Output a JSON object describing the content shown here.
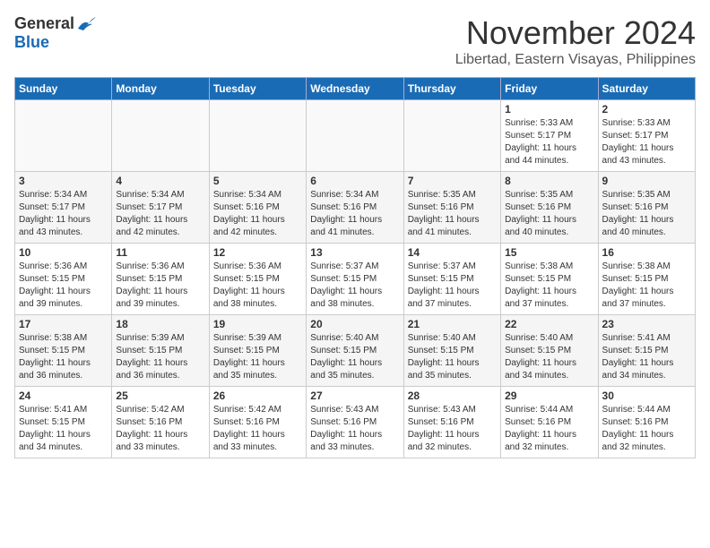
{
  "header": {
    "logo_general": "General",
    "logo_blue": "Blue",
    "month_title": "November 2024",
    "location": "Libertad, Eastern Visayas, Philippines"
  },
  "weekdays": [
    "Sunday",
    "Monday",
    "Tuesday",
    "Wednesday",
    "Thursday",
    "Friday",
    "Saturday"
  ],
  "weeks": [
    [
      {
        "day": "",
        "info": ""
      },
      {
        "day": "",
        "info": ""
      },
      {
        "day": "",
        "info": ""
      },
      {
        "day": "",
        "info": ""
      },
      {
        "day": "",
        "info": ""
      },
      {
        "day": "1",
        "info": "Sunrise: 5:33 AM\nSunset: 5:17 PM\nDaylight: 11 hours\nand 44 minutes."
      },
      {
        "day": "2",
        "info": "Sunrise: 5:33 AM\nSunset: 5:17 PM\nDaylight: 11 hours\nand 43 minutes."
      }
    ],
    [
      {
        "day": "3",
        "info": "Sunrise: 5:34 AM\nSunset: 5:17 PM\nDaylight: 11 hours\nand 43 minutes."
      },
      {
        "day": "4",
        "info": "Sunrise: 5:34 AM\nSunset: 5:17 PM\nDaylight: 11 hours\nand 42 minutes."
      },
      {
        "day": "5",
        "info": "Sunrise: 5:34 AM\nSunset: 5:16 PM\nDaylight: 11 hours\nand 42 minutes."
      },
      {
        "day": "6",
        "info": "Sunrise: 5:34 AM\nSunset: 5:16 PM\nDaylight: 11 hours\nand 41 minutes."
      },
      {
        "day": "7",
        "info": "Sunrise: 5:35 AM\nSunset: 5:16 PM\nDaylight: 11 hours\nand 41 minutes."
      },
      {
        "day": "8",
        "info": "Sunrise: 5:35 AM\nSunset: 5:16 PM\nDaylight: 11 hours\nand 40 minutes."
      },
      {
        "day": "9",
        "info": "Sunrise: 5:35 AM\nSunset: 5:16 PM\nDaylight: 11 hours\nand 40 minutes."
      }
    ],
    [
      {
        "day": "10",
        "info": "Sunrise: 5:36 AM\nSunset: 5:15 PM\nDaylight: 11 hours\nand 39 minutes."
      },
      {
        "day": "11",
        "info": "Sunrise: 5:36 AM\nSunset: 5:15 PM\nDaylight: 11 hours\nand 39 minutes."
      },
      {
        "day": "12",
        "info": "Sunrise: 5:36 AM\nSunset: 5:15 PM\nDaylight: 11 hours\nand 38 minutes."
      },
      {
        "day": "13",
        "info": "Sunrise: 5:37 AM\nSunset: 5:15 PM\nDaylight: 11 hours\nand 38 minutes."
      },
      {
        "day": "14",
        "info": "Sunrise: 5:37 AM\nSunset: 5:15 PM\nDaylight: 11 hours\nand 37 minutes."
      },
      {
        "day": "15",
        "info": "Sunrise: 5:38 AM\nSunset: 5:15 PM\nDaylight: 11 hours\nand 37 minutes."
      },
      {
        "day": "16",
        "info": "Sunrise: 5:38 AM\nSunset: 5:15 PM\nDaylight: 11 hours\nand 37 minutes."
      }
    ],
    [
      {
        "day": "17",
        "info": "Sunrise: 5:38 AM\nSunset: 5:15 PM\nDaylight: 11 hours\nand 36 minutes."
      },
      {
        "day": "18",
        "info": "Sunrise: 5:39 AM\nSunset: 5:15 PM\nDaylight: 11 hours\nand 36 minutes."
      },
      {
        "day": "19",
        "info": "Sunrise: 5:39 AM\nSunset: 5:15 PM\nDaylight: 11 hours\nand 35 minutes."
      },
      {
        "day": "20",
        "info": "Sunrise: 5:40 AM\nSunset: 5:15 PM\nDaylight: 11 hours\nand 35 minutes."
      },
      {
        "day": "21",
        "info": "Sunrise: 5:40 AM\nSunset: 5:15 PM\nDaylight: 11 hours\nand 35 minutes."
      },
      {
        "day": "22",
        "info": "Sunrise: 5:40 AM\nSunset: 5:15 PM\nDaylight: 11 hours\nand 34 minutes."
      },
      {
        "day": "23",
        "info": "Sunrise: 5:41 AM\nSunset: 5:15 PM\nDaylight: 11 hours\nand 34 minutes."
      }
    ],
    [
      {
        "day": "24",
        "info": "Sunrise: 5:41 AM\nSunset: 5:15 PM\nDaylight: 11 hours\nand 34 minutes."
      },
      {
        "day": "25",
        "info": "Sunrise: 5:42 AM\nSunset: 5:16 PM\nDaylight: 11 hours\nand 33 minutes."
      },
      {
        "day": "26",
        "info": "Sunrise: 5:42 AM\nSunset: 5:16 PM\nDaylight: 11 hours\nand 33 minutes."
      },
      {
        "day": "27",
        "info": "Sunrise: 5:43 AM\nSunset: 5:16 PM\nDaylight: 11 hours\nand 33 minutes."
      },
      {
        "day": "28",
        "info": "Sunrise: 5:43 AM\nSunset: 5:16 PM\nDaylight: 11 hours\nand 32 minutes."
      },
      {
        "day": "29",
        "info": "Sunrise: 5:44 AM\nSunset: 5:16 PM\nDaylight: 11 hours\nand 32 minutes."
      },
      {
        "day": "30",
        "info": "Sunrise: 5:44 AM\nSunset: 5:16 PM\nDaylight: 11 hours\nand 32 minutes."
      }
    ]
  ]
}
